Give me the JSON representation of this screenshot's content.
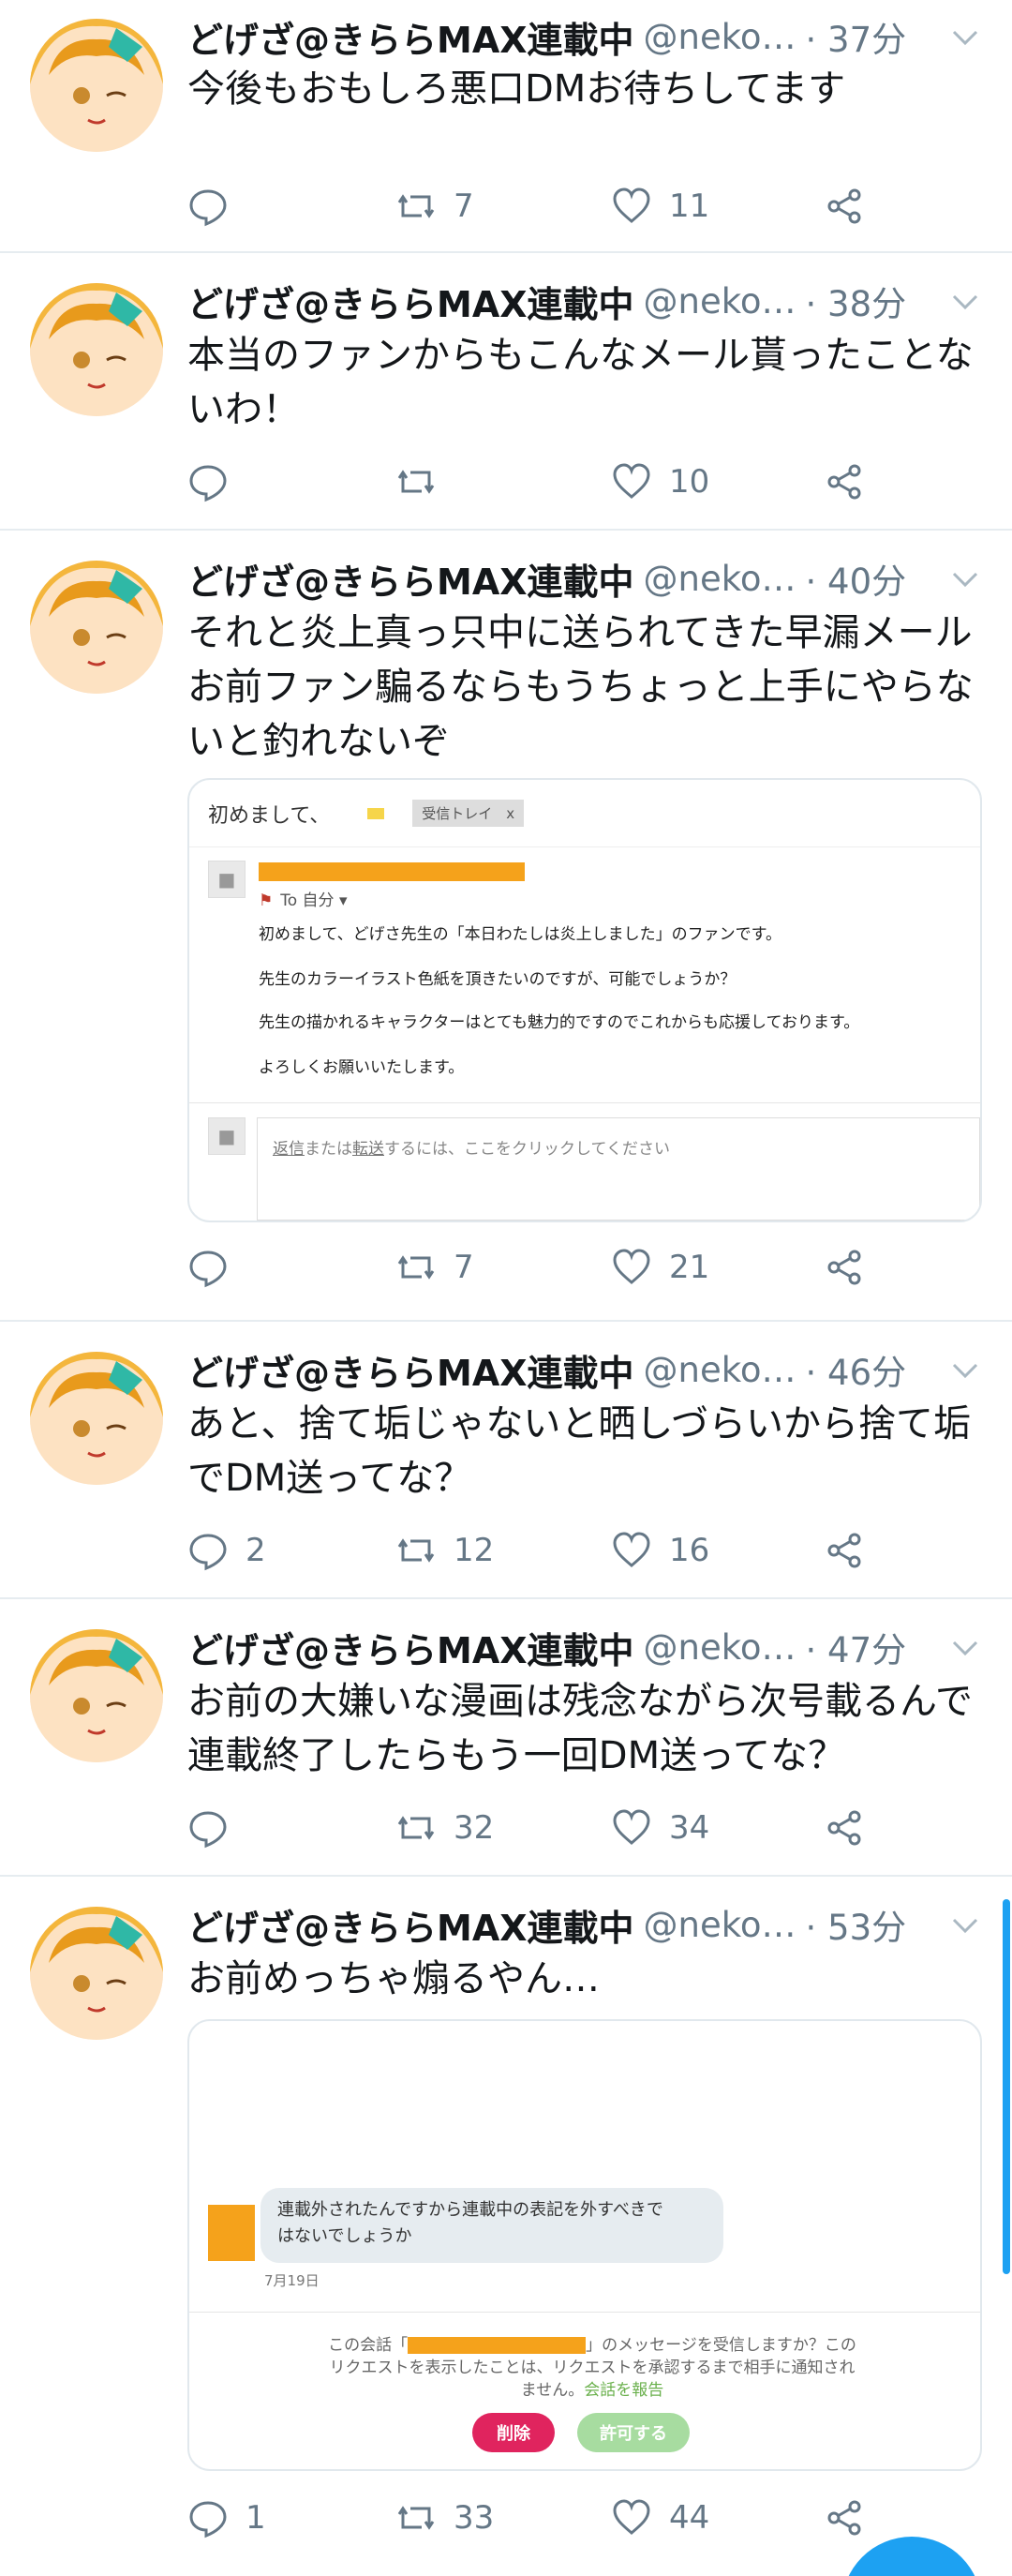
{
  "tweets": [
    {
      "name": "どげざ@きららMAX連載中",
      "handle": "@neko…",
      "time": "· 37分",
      "text": "今後もおもしろ悪口DMお待ちしてます",
      "replies": "",
      "retweets": "7",
      "likes": "11"
    },
    {
      "name": "どげざ@きららMAX連載中",
      "handle": "@neko…",
      "time": "· 38分",
      "text": "本当のファンからもこんなメール貰ったことないわ！",
      "replies": "",
      "retweets": "",
      "likes": "10"
    },
    {
      "name": "どげざ@きららMAX連載中",
      "handle": "@neko…",
      "time": "· 40分",
      "text": "それと炎上真っ只中に送られてきた早漏メールお前ファン騙るならもうちょっと上手にやらないと釣れないぞ",
      "replies": "",
      "retweets": "7",
      "likes": "21"
    },
    {
      "name": "どげざ@きららMAX連載中",
      "handle": "@neko…",
      "time": "· 46分",
      "text": "あと、捨て垢じゃないと晒しづらいから捨て垢でDM送ってな？",
      "replies": "2",
      "retweets": "12",
      "likes": "16"
    },
    {
      "name": "どげざ@きららMAX連載中",
      "handle": "@neko…",
      "time": "· 47分",
      "text": "お前の大嫌いな漫画は残念ながら次号載るんで連載終了したらもう一回DM送ってな？",
      "replies": "",
      "retweets": "32",
      "likes": "34"
    },
    {
      "name": "どげざ@きららMAX連載中",
      "handle": "@neko…",
      "time": "· 53分",
      "text": "お前めっちゃ煽るやん…",
      "replies": "1",
      "retweets": "33",
      "likes": "44"
    }
  ],
  "email": {
    "subject": "初めまして、",
    "label": "受信トレイ　x",
    "to": "To 自分",
    "lines": [
      "初めまして、どげさ先生の「本日わたしは炎上しました」のファンです。",
      "先生のカラーイラスト色紙を頂きたいのですが、可能でしょうか？",
      "先生の描かれるキャラクターはとても魅力的ですのでこれからも応援しております。",
      "よろしくお願いいたします。"
    ],
    "reply_prefix": "返信",
    "reply_mid": "または",
    "reply_forward": "転送",
    "reply_suffix": "するには、ここをクリックしてください"
  },
  "dm": {
    "message_line1": "連載外されたんですから連載中の表記を外すべきで",
    "message_line2": "はないでしょうか",
    "date": "7月19日",
    "notice_before": "この会話「",
    "notice_after": "」のメッセージを受信しますか？この",
    "notice_line2": "リクエストを表示したことは、リクエストを承認するまで相手に通知され",
    "notice_line3": "ません。",
    "report_link": "会話を報告",
    "delete_label": "削除",
    "accept_label": "許可する"
  },
  "colors": {
    "accent": "#1da1f2",
    "muted": "#657786",
    "redaction": "#f5a21b",
    "delete": "#e0245e",
    "accept": "#a7dca0"
  },
  "icons": [
    "reply-icon",
    "retweet-icon",
    "like-icon",
    "share-icon",
    "caret-down-icon"
  ]
}
